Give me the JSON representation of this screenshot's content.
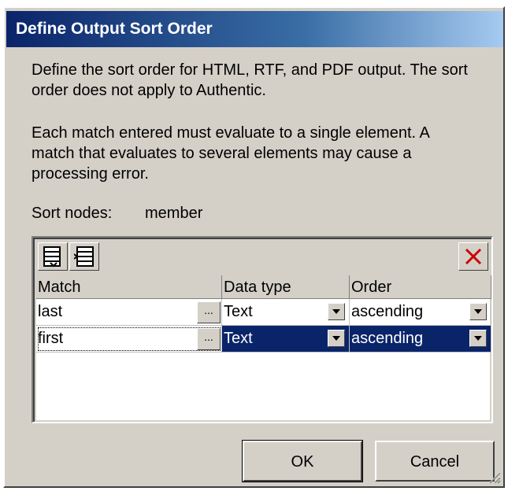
{
  "dialog": {
    "title": "Define Output Sort Order",
    "description_1": "Define the sort order for HTML, RTF, and PDF output. The sort order does not apply to Authentic.",
    "description_2": "Each match entered must evaluate to a single element. A match that evaluates to several elements may cause a processing error.",
    "sort_nodes_label": "Sort nodes:",
    "sort_nodes_value": "member"
  },
  "toolbar": {
    "icons": [
      "append-row-icon",
      "insert-row-icon",
      "delete-row-icon"
    ]
  },
  "table": {
    "columns": [
      "Match",
      "Data type",
      "Order"
    ],
    "rows": [
      {
        "match": "last",
        "ellipsis": "...",
        "data_type": "Text",
        "order": "ascending",
        "selected": false
      },
      {
        "match": "first",
        "ellipsis": "...",
        "data_type": "Text",
        "order": "ascending",
        "selected": true
      }
    ]
  },
  "buttons": {
    "ok": "OK",
    "cancel": "Cancel"
  },
  "colors": {
    "title_start": "#0a246a",
    "selection": "#0a246a",
    "dialog_bg": "#d4d0c8",
    "delete_x": "#cc0000"
  }
}
